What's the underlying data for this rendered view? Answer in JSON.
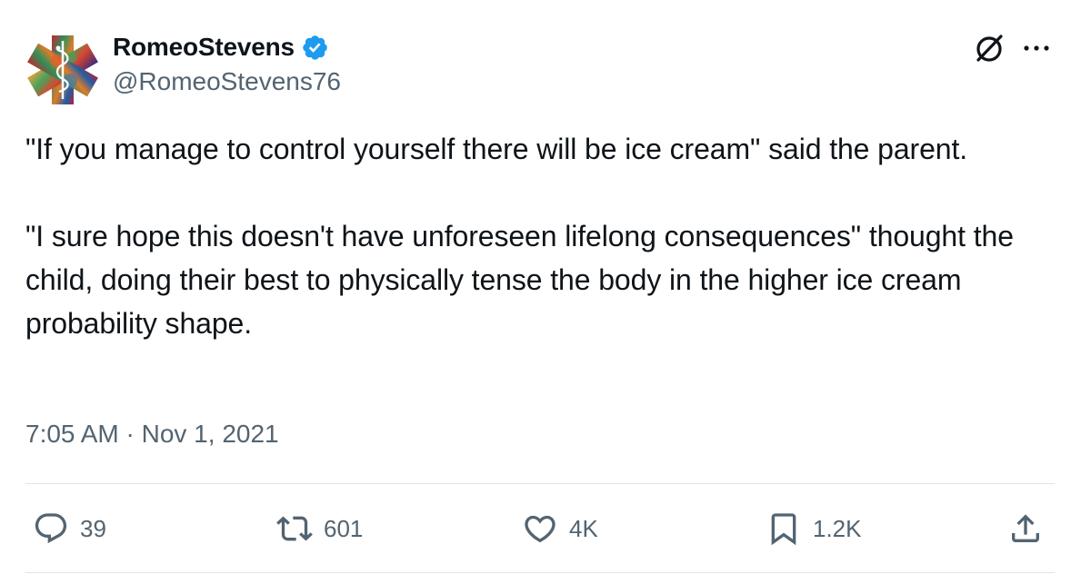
{
  "author": {
    "display_name": "RomeoStevens",
    "handle": "@RomeoStevens76",
    "verified": true
  },
  "tweet": {
    "paragraphs": [
      "\"If you manage to control yourself there will be ice cream\" said the parent.",
      "\"I sure hope this doesn't have unforeseen lifelong consequences\" thought the child, doing their best to physically tense the body in the higher ice cream probability shape."
    ],
    "timestamp": "7:05 AM · Nov 1, 2021"
  },
  "actions": {
    "reply_count": "39",
    "retweet_count": "601",
    "like_count": "4K",
    "bookmark_count": "1.2K"
  },
  "icons": {
    "avatar": "medical-star-avatar",
    "verified": "verified-badge-icon",
    "grok": "grok-icon",
    "more": "more-icon",
    "reply": "reply-icon",
    "retweet": "retweet-icon",
    "like": "heart-icon",
    "bookmark": "bookmark-icon",
    "share": "share-icon"
  },
  "colors": {
    "text": "#0f1419",
    "secondary_text": "#536471",
    "verified_blue": "#1d9bf0",
    "divider": "#dfe4e8"
  }
}
